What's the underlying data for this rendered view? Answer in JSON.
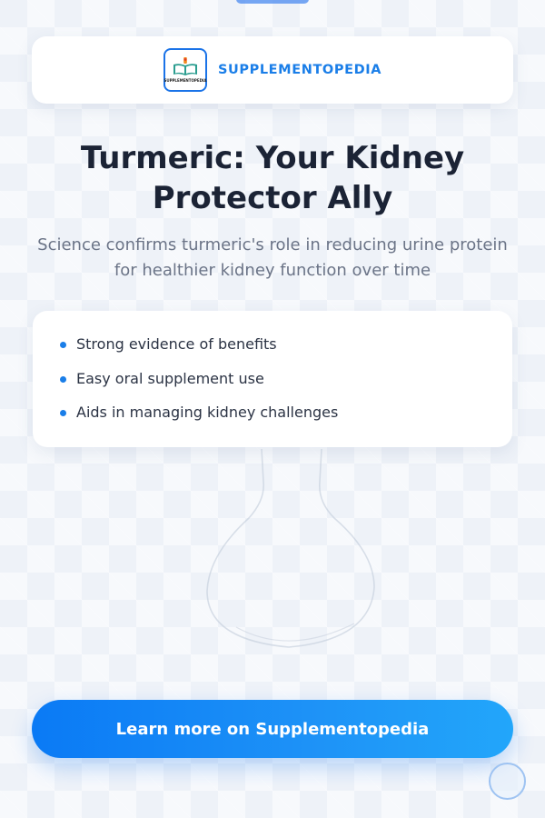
{
  "brand": {
    "name": "SUPPLEMENTOPEDIA",
    "logo_text": "SUPPLEMENTOPEDIA",
    "accent_color": "#1a7ee8"
  },
  "headline": "Turmeric: Your Kidney Protector Ally",
  "subtitle": "Science confirms turmeric's role in reducing urine protein for healthier kidney function over time",
  "benefits": [
    "Strong evidence of benefits",
    "Easy oral supplement use",
    "Aids in managing kidney challenges"
  ],
  "cta": {
    "label": "Learn more on Supplementopedia",
    "color_start": "#0a7af5",
    "color_end": "#22a6fa"
  },
  "icons": {
    "logo": "open-book-icon",
    "background_art": "flask-icon",
    "corner": "circle-icon"
  }
}
